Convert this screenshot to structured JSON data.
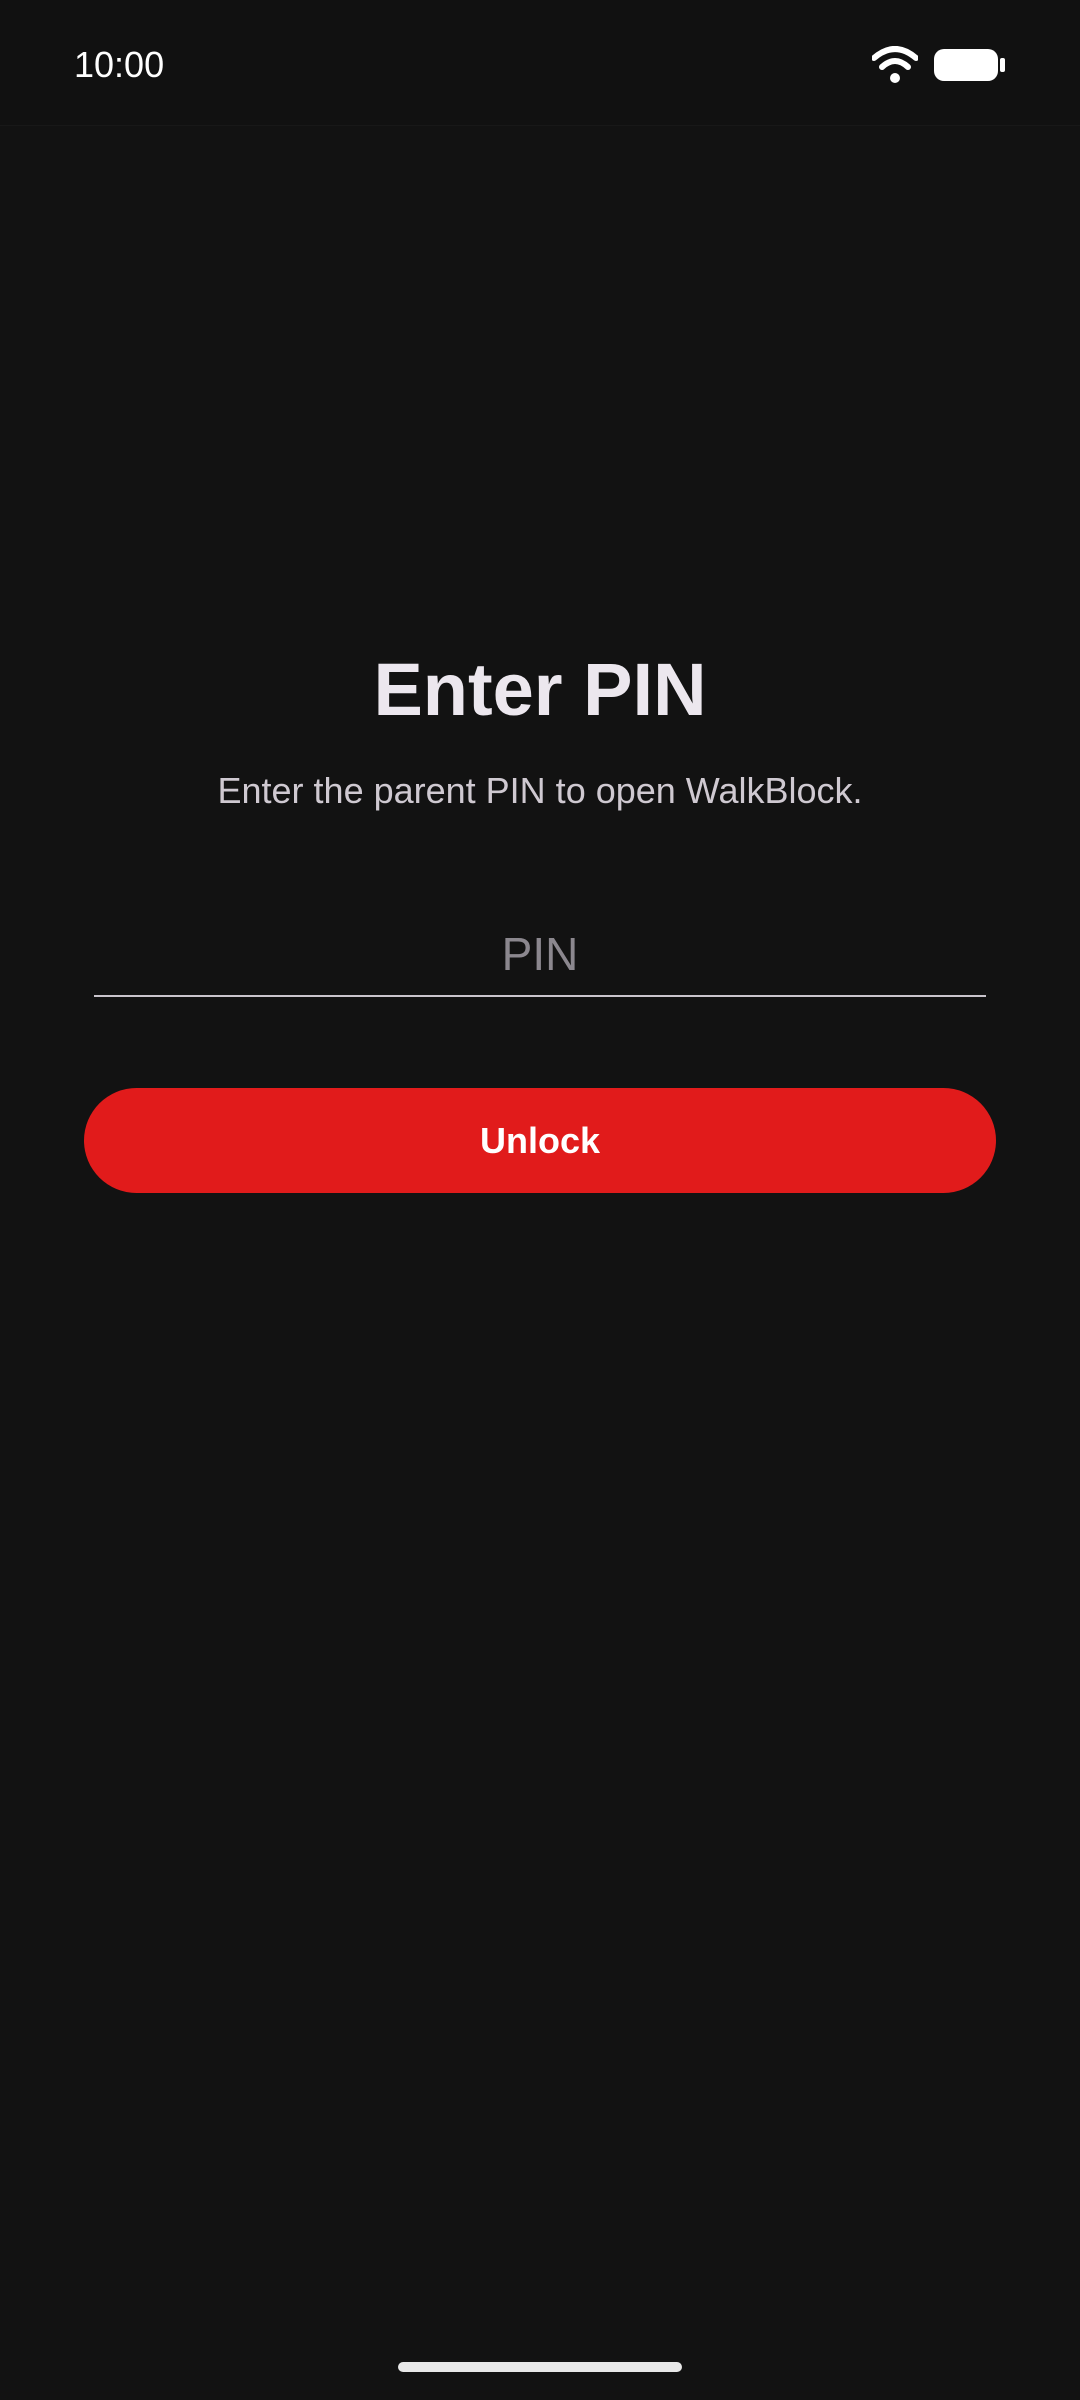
{
  "status_bar": {
    "time": "10:00",
    "icons": [
      "wifi-icon",
      "battery-icon"
    ]
  },
  "screen": {
    "title": "Enter PIN",
    "subtitle": "Enter the parent PIN to open WalkBlock.",
    "pin_field": {
      "placeholder": "PIN",
      "value": ""
    },
    "unlock_button_label": "Unlock"
  },
  "colors": {
    "background": "#121212",
    "accent": "#E11B1B",
    "title_text": "#ECE7EE",
    "subtitle_text": "#CFC9D1",
    "placeholder_text": "#8B878E"
  }
}
